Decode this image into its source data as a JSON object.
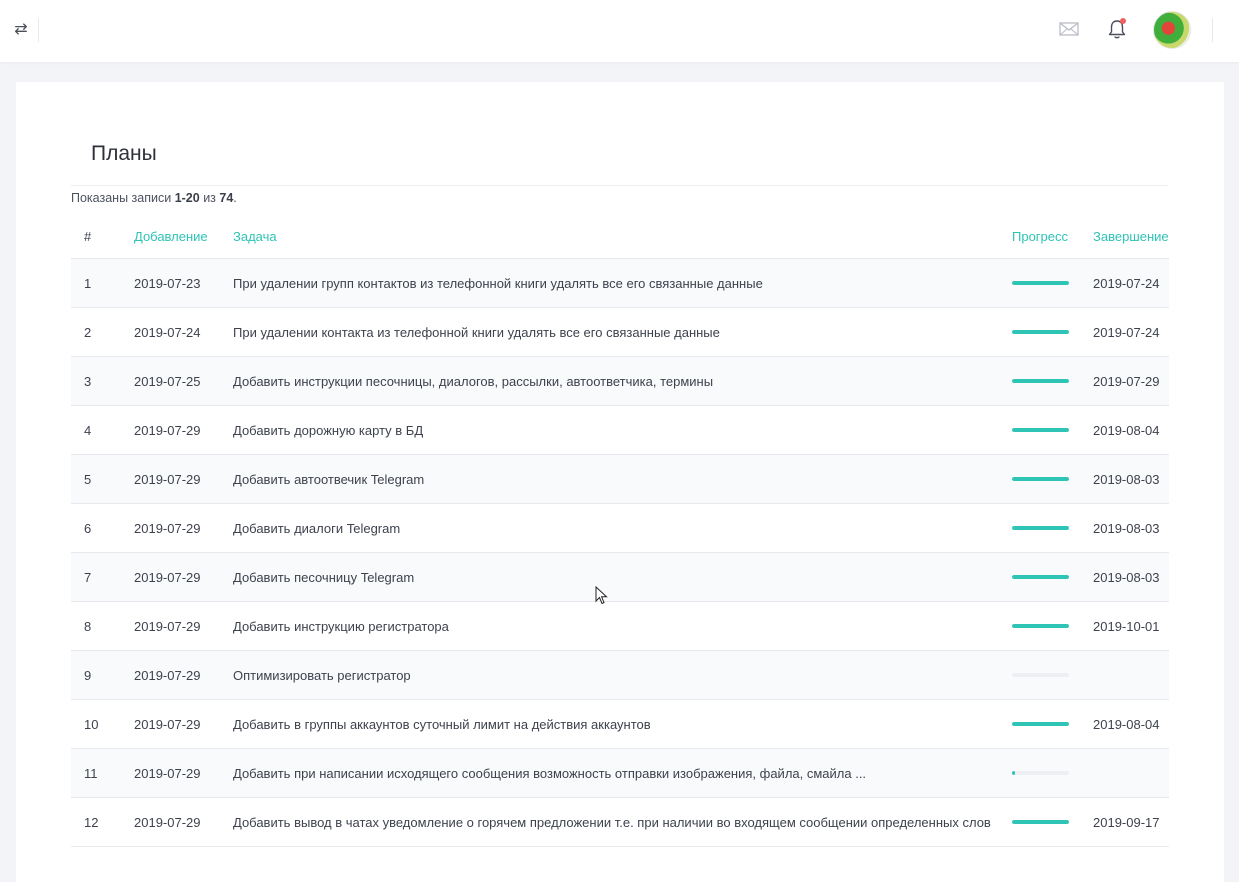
{
  "header": {
    "toggle_icon": "⇄",
    "icons": [
      "swap-icon",
      "mail-icon",
      "bell-icon"
    ]
  },
  "page": {
    "title": "Планы",
    "summary_prefix": "Показаны записи ",
    "summary_range": "1-20",
    "summary_mid": " из ",
    "summary_total": "74",
    "summary_suffix": "."
  },
  "table": {
    "columns": {
      "num": "#",
      "added": "Добавление",
      "task": "Задача",
      "progress": "Прогресс",
      "completed": "Завершение"
    },
    "rows": [
      {
        "num": "1",
        "added": "2019-07-23",
        "task": "При удалении групп контактов из телефонной книги удалять все его связанные данные",
        "progress": 100,
        "completed": "2019-07-24"
      },
      {
        "num": "2",
        "added": "2019-07-24",
        "task": "При удалении контакта из телефонной книги удалять все его связанные данные",
        "progress": 100,
        "completed": "2019-07-24"
      },
      {
        "num": "3",
        "added": "2019-07-25",
        "task": "Добавить инструкции песочницы, диалогов, рассылки, автоответчика, термины",
        "progress": 100,
        "completed": "2019-07-29"
      },
      {
        "num": "4",
        "added": "2019-07-29",
        "task": "Добавить дорожную карту в БД",
        "progress": 100,
        "completed": "2019-08-04"
      },
      {
        "num": "5",
        "added": "2019-07-29",
        "task": "Добавить автоотвечик Telegram",
        "progress": 100,
        "completed": "2019-08-03"
      },
      {
        "num": "6",
        "added": "2019-07-29",
        "task": "Добавить диалоги Telegram",
        "progress": 100,
        "completed": "2019-08-03"
      },
      {
        "num": "7",
        "added": "2019-07-29",
        "task": "Добавить песочницу Telegram",
        "progress": 100,
        "completed": "2019-08-03"
      },
      {
        "num": "8",
        "added": "2019-07-29",
        "task": "Добавить инструкцию регистратора",
        "progress": 100,
        "completed": "2019-10-01"
      },
      {
        "num": "9",
        "added": "2019-07-29",
        "task": "Оптимизировать регистратор",
        "progress": 0,
        "completed": ""
      },
      {
        "num": "10",
        "added": "2019-07-29",
        "task": "Добавить в группы аккаунтов суточный лимит на действия аккаунтов",
        "progress": 100,
        "completed": "2019-08-04"
      },
      {
        "num": "11",
        "added": "2019-07-29",
        "task": "Добавить при написании исходящего сообщения возможность отправки изображения, файла, смайла ...",
        "progress": 5,
        "completed": ""
      },
      {
        "num": "12",
        "added": "2019-07-29",
        "task": "Добавить вывод в чатах уведомление о горячем предложении т.е. при наличии во входящем сообщении определенных слов",
        "progress": 100,
        "completed": "2019-09-17"
      }
    ]
  },
  "colors": {
    "accent": "#2ec4b6",
    "notification_dot": "#f0605d",
    "page_bg": "#f3f4f8"
  }
}
